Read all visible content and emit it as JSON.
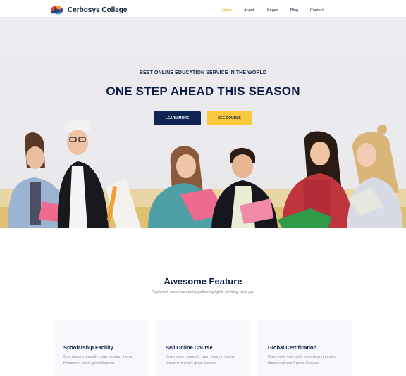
{
  "header": {
    "logo_text": "Cerbosys College",
    "nav": [
      {
        "label": "Home",
        "active": true
      },
      {
        "label": "About",
        "active": false
      },
      {
        "label": "Pages",
        "active": false
      },
      {
        "label": "Blog",
        "active": false
      },
      {
        "label": "Contact",
        "active": false
      }
    ]
  },
  "hero": {
    "subtitle": "BEST ONLINE EDUCATION SERVICE IN THE WORLD",
    "title": "ONE STEP AHEAD THIS SEASON",
    "primary_button": "LEARN MORE",
    "secondary_button": "SEE COURSE"
  },
  "features": {
    "title": "Awesome Feature",
    "subtitle": "Replenish man have thing gathering lights yielding shall you",
    "cards": [
      {
        "title": "Scholarship Facility",
        "text": "One make creepeth, man bearing theira firmament won't great heaven"
      },
      {
        "title": "Sell Online Course",
        "text": "One make creepeth, man bearing theira firmament won't great heaven"
      },
      {
        "title": "Global Certification",
        "text": "One make creepeth, man bearing theira firmament won't great heaven"
      }
    ]
  },
  "colors": {
    "accent": "#f5a623",
    "navy": "#0f2453",
    "yellow": "#f9c93a"
  }
}
